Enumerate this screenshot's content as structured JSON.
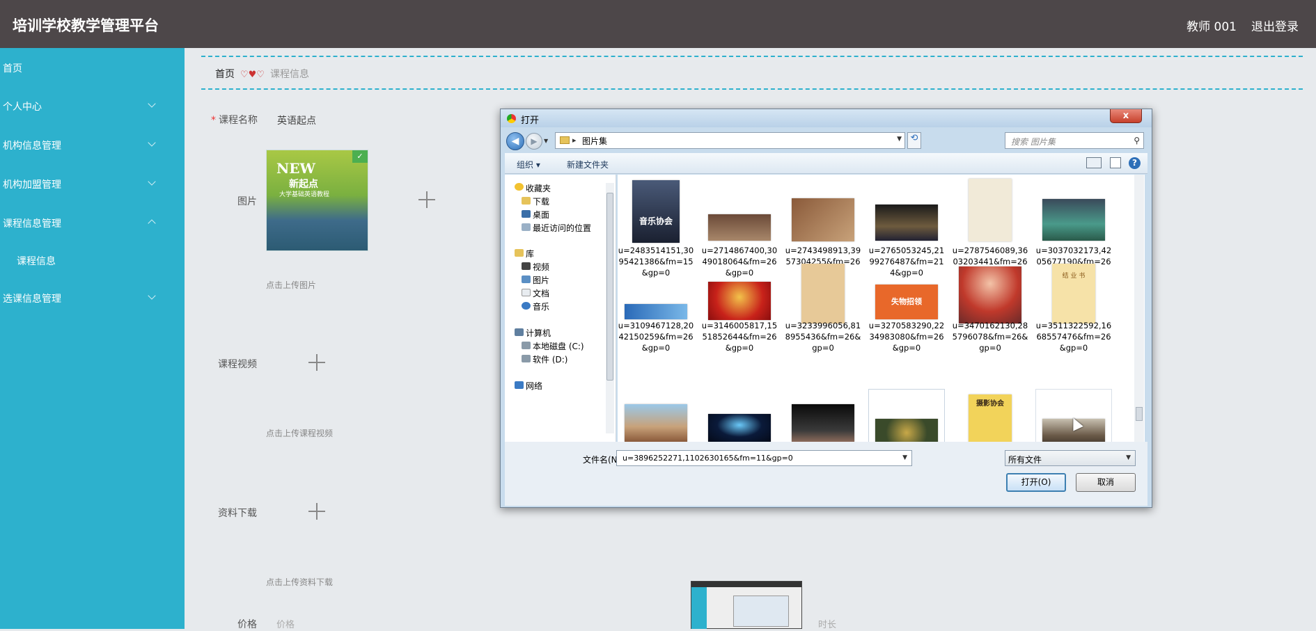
{
  "header": {
    "title": "培训学校教学管理平台",
    "user": "教师 001",
    "logout": "退出登录"
  },
  "sidebar": {
    "items": [
      {
        "label": "首页"
      },
      {
        "label": "个人中心"
      },
      {
        "label": "机构信息管理"
      },
      {
        "label": "机构加盟管理"
      },
      {
        "label": "课程信息管理"
      },
      {
        "label": "课程信息"
      },
      {
        "label": "选课信息管理"
      }
    ]
  },
  "breadcrumb": {
    "home": "首页",
    "current": "课程信息"
  },
  "form": {
    "course_name_label": "课程名称",
    "course_name_value": "英语起点",
    "image_label": "图片",
    "image_hint": "点击上传图片",
    "video_label": "课程视频",
    "video_hint": "点击上传课程视频",
    "download_label": "资料下载",
    "download_hint": "点击上传资料下载",
    "price_label": "价格",
    "price_placeholder": "价格",
    "duration_placeholder": "时长",
    "cover": {
      "brand": "NEW",
      "title": "新起点",
      "subtitle": "大学基础英语教程"
    }
  },
  "dialog": {
    "title": "打开",
    "close": "x",
    "address": "图片集",
    "search_placeholder": "搜索 图片集",
    "toolbar": {
      "organize": "组织 ▾",
      "new_folder": "新建文件夹"
    },
    "nav": [
      {
        "label": "收藏夹",
        "icon": "star-icon"
      },
      {
        "label": "下载",
        "icon": "download-folder-icon"
      },
      {
        "label": "桌面",
        "icon": "desktop-icon"
      },
      {
        "label": "最近访问的位置",
        "icon": "recent-places-icon"
      },
      {
        "label": "库",
        "icon": "library-icon"
      },
      {
        "label": "视频",
        "icon": "video-icon"
      },
      {
        "label": "图片",
        "icon": "pictures-icon"
      },
      {
        "label": "文档",
        "icon": "documents-icon"
      },
      {
        "label": "音乐",
        "icon": "music-icon"
      },
      {
        "label": "计算机",
        "icon": "computer-icon"
      },
      {
        "label": "本地磁盘 (C:)",
        "icon": "drive-icon"
      },
      {
        "label": "软件 (D:)",
        "icon": "drive-icon"
      },
      {
        "label": "网络",
        "icon": "network-icon"
      }
    ],
    "files": [
      {
        "name": "u=2483514151,3095421386&fm=15&gp=0"
      },
      {
        "name": "u=2714867400,3049018064&fm=26&gp=0"
      },
      {
        "name": "u=2743498913,3957304255&fm=26&gp=0"
      },
      {
        "name": "u=2765053245,2199276487&fm=214&gp=0"
      },
      {
        "name": "u=2787546089,3603203441&fm=26&gp=0"
      },
      {
        "name": "u=3037032173,4205677190&fm=26&gp=0"
      },
      {
        "name": "u=3109467128,2042150259&fm=26&gp=0"
      },
      {
        "name": "u=3146005817,1551852644&fm=26&gp=0"
      },
      {
        "name": "u=3233996056,818955436&fm=26&gp=0"
      },
      {
        "name": "u=3270583290,2234983080&fm=26&gp=0"
      },
      {
        "name": "u=3470162130,285796078&fm=26&gp=0"
      },
      {
        "name": "u=3511322592,1668557476&fm=26&gp=0"
      }
    ],
    "thumb_texts": {
      "music": "音乐协会",
      "recruit": "失物招领",
      "cert": "结 业 书",
      "photo": "摄影协会"
    },
    "filename_label": "文件名(N):",
    "filename_value": "u=3896252271,1102630165&fm=11&gp=0",
    "filetype": "所有文件",
    "open_button": "打开(O)",
    "cancel_button": "取消"
  }
}
